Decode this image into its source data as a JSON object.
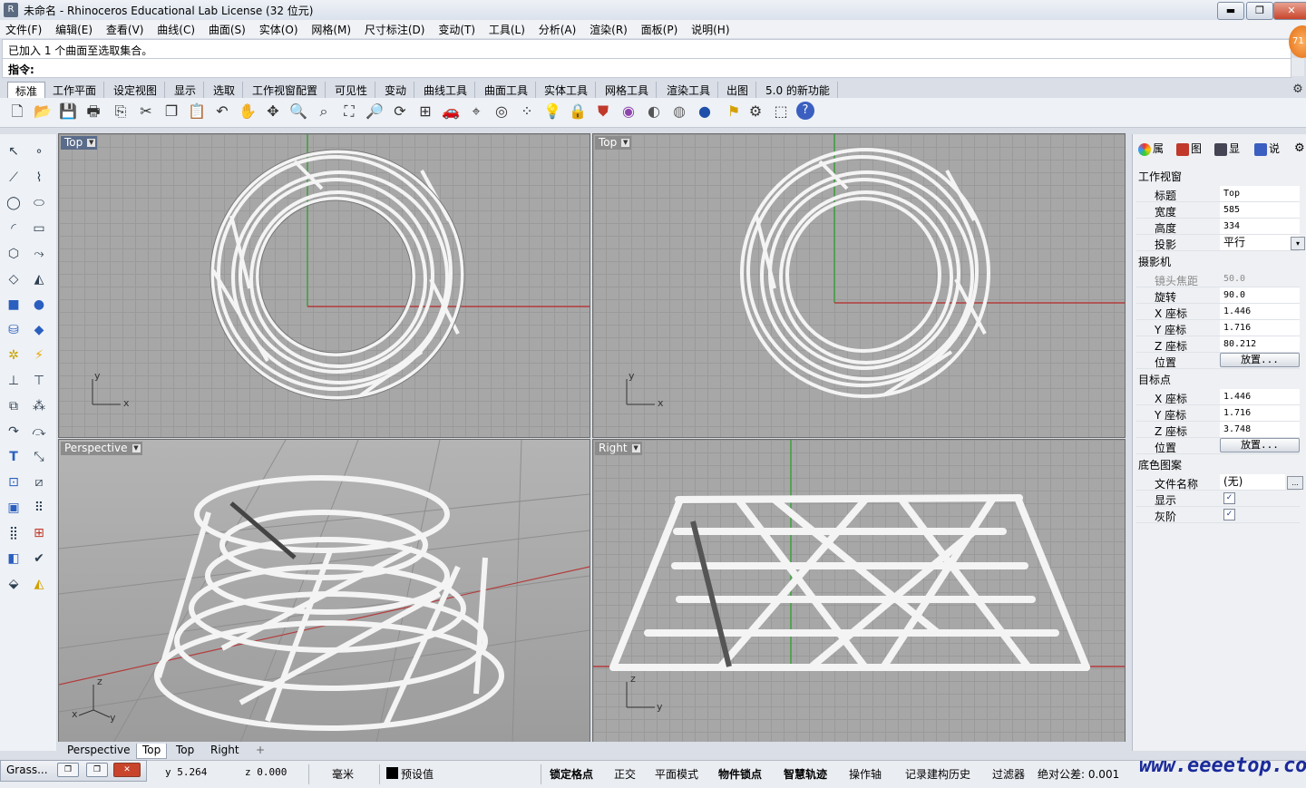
{
  "window": {
    "title": "未命名 - Rhinoceros Educational Lab License (32 位元)",
    "min_label": "▬",
    "max_label": "❐",
    "close_label": "✕"
  },
  "menu": [
    "文件(F)",
    "编辑(E)",
    "查看(V)",
    "曲线(C)",
    "曲面(S)",
    "实体(O)",
    "网格(M)",
    "尺寸标注(D)",
    "变动(T)",
    "工具(L)",
    "分析(A)",
    "渲染(R)",
    "面板(P)",
    "说明(H)"
  ],
  "command": {
    "history": "已加入 1 个曲面至选取集合。",
    "prompt_label": "指令:",
    "value": ""
  },
  "notification_badge": "71",
  "toolbar_tabs": [
    "标准",
    "工作平面",
    "设定视图",
    "显示",
    "选取",
    "工作视窗配置",
    "可见性",
    "变动",
    "曲线工具",
    "曲面工具",
    "实体工具",
    "网格工具",
    "渲染工具",
    "出图",
    "5.0 的新功能"
  ],
  "toolbar_icons": [
    "new-file-icon",
    "open-folder-icon",
    "save-icon",
    "print-icon",
    "import-icon",
    "cut-icon",
    "copy-icon",
    "paste-icon",
    "undo-icon",
    "pan-hand-icon",
    "move-view-icon",
    "zoom-icon",
    "zoom-window-icon",
    "zoom-extents-icon",
    "zoom-selected-icon",
    "rotate-view-icon",
    "four-viewports-icon",
    "car-icon",
    "camera-icon",
    "grid-snap-icon",
    "points-icon",
    "light-bulb-icon",
    "lock-icon",
    "shield-icon",
    "color-wheel-icon",
    "render-sphere-icon",
    "shaded-sphere-icon",
    "blue-sphere-icon",
    "flag-icon",
    "settings-gear-icon",
    "select-frame-icon",
    "help-icon"
  ],
  "left_tools": [
    "select-arrow-icon",
    "point-icon",
    "polyline-icon",
    "curve-points-icon",
    "circle-icon",
    "ellipse-icon",
    "arc-icon",
    "rectangle-icon",
    "polygon-icon",
    "curve-edit-icon",
    "surface-corner-icon",
    "surface-curve-icon",
    "box-icon",
    "sphere-icon",
    "cylinder-icon",
    "plane-icon",
    "boolean-icon",
    "explode-icon",
    "split-icon",
    "trim-icon",
    "group-icon",
    "fillet-icon",
    "chamfer-icon",
    "text-icon",
    "dimension-icon",
    "array-icon",
    "mirror-icon",
    "transform-icon",
    "analysis-icon",
    "array-grid-icon",
    "align-icon",
    "curvature-icon",
    "check-icon",
    "render-icon",
    "material-icon"
  ],
  "viewports": {
    "top_left": {
      "label": "Top",
      "axis_x": "x",
      "axis_y": "y"
    },
    "top_right": {
      "label": "Top",
      "axis_x": "x",
      "axis_y": "y"
    },
    "bottom_left": {
      "label": "Perspective",
      "axis_x": "x",
      "axis_y": "y",
      "axis_z": "z"
    },
    "bottom_right": {
      "label": "Right",
      "axis_y": "y",
      "axis_z": "z"
    }
  },
  "viewport_tabs": [
    "Perspective",
    "Top",
    "Top",
    "Right"
  ],
  "viewport_add_label": "+",
  "panel": {
    "tabs": [
      "属",
      "图",
      "显",
      "说"
    ],
    "viewport_section": "工作视窗",
    "title_label": "标题",
    "title_value": "Top",
    "width_label": "宽度",
    "width_value": "585",
    "height_label": "高度",
    "height_value": "334",
    "projection_label": "投影",
    "projection_value": "平行",
    "camera_section": "摄影机",
    "lens_label": "镜头焦距",
    "lens_value": "50.0",
    "rotation_label": "旋转",
    "rotation_value": "90.0",
    "cam_x_label": "X 座标",
    "cam_x_value": "1.446",
    "cam_y_label": "Y 座标",
    "cam_y_value": "1.716",
    "cam_z_label": "Z 座标",
    "cam_z_value": "80.212",
    "cam_pos_label": "位置",
    "cam_pos_button": "放置...",
    "target_section": "目标点",
    "tgt_x_label": "X 座标",
    "tgt_x_value": "1.446",
    "tgt_y_label": "Y 座标",
    "tgt_y_value": "1.716",
    "tgt_z_label": "Z 座标",
    "tgt_z_value": "3.748",
    "tgt_pos_label": "位置",
    "tgt_pos_button": "放置...",
    "wallpaper_section": "底色图案",
    "file_label": "文件名称",
    "file_value": "(无)",
    "file_button": "...",
    "show_label": "显示",
    "gray_label": "灰阶",
    "check_mark": "✓",
    "dropdown_mark": "▾"
  },
  "status": {
    "grass_label": "Grass...",
    "y_value": "y 5.264",
    "z_value": "z 0.000",
    "unit": "毫米",
    "layer": "预设值",
    "snap": "锁定格点",
    "ortho": "正交",
    "planar": "平面模式",
    "osnap": "物件锁点",
    "smarttrack": "智慧轨迹",
    "gumball": "操作轴",
    "history": "记录建构历史",
    "filter": "过滤器",
    "tolerance": "绝对公差: 0.001"
  },
  "watermark": "www.eeeetop.com",
  "colors": {
    "viewport_bg": "#a7a7a7",
    "grid": "#9a9a9a",
    "x_axis": "#b43c3c",
    "y_axis": "#3ca03c",
    "active_label": "#5a6c8a"
  }
}
